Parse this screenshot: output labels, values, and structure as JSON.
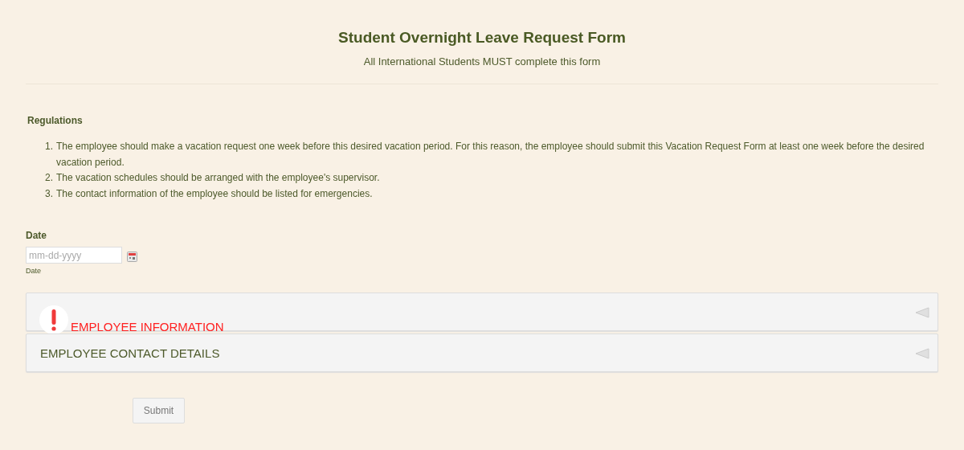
{
  "header": {
    "title": "Student Overnight Leave Request Form",
    "subtitle": "All International Students MUST complete this form"
  },
  "regulations": {
    "heading": "Regulations",
    "items": [
      {
        "number": "1.",
        "text": "The employee should make a vacation request one week before this desired vacation period. For this reason, the employee should submit this Vacation Request Form at least one week before the desired vacation period."
      },
      {
        "number": "2.",
        "text": "The vacation schedules should be arranged with the employee's supervisor."
      },
      {
        "number": "3.",
        "text": "The contact information of the employee should be listed for emergencies."
      }
    ]
  },
  "date": {
    "label": "Date",
    "placeholder": "mm-dd-yyyy",
    "sublabel": "Date"
  },
  "sections": [
    {
      "title": "EMPLOYEE INFORMATION",
      "error": true,
      "expanded": false
    },
    {
      "title": "EMPLOYEE CONTACT DETAILS",
      "error": false,
      "expanded": false
    }
  ],
  "submit": "Submit"
}
